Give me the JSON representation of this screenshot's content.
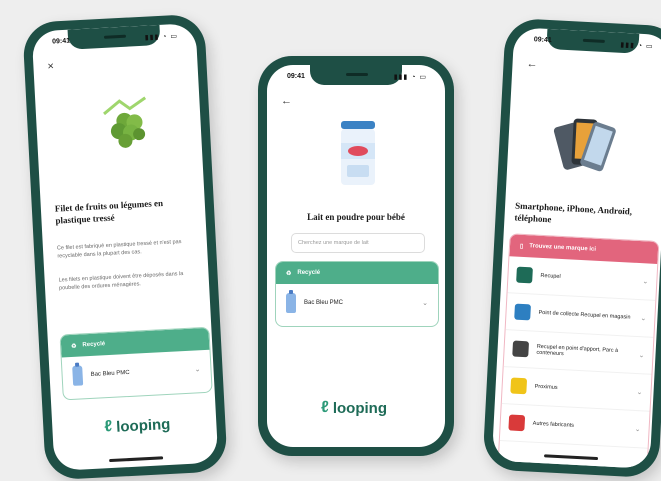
{
  "status": {
    "time": "09:41",
    "icons": "▮▮▮ ◔ ▭"
  },
  "phone1": {
    "close": "×",
    "title": "Filet de fruits ou légumes en plastique tressé",
    "para1": "Ce filet est fabriqué en plastique tressé et n'est pas recyclable dans la plupart des cas.",
    "para2": "Les filets en plastique doivent être déposés dans la poubelle des ordures ménagères.",
    "card_head": "Recyclé",
    "card_item": "Bac Bleu PMC",
    "logo": "looping"
  },
  "phone2": {
    "back": "←",
    "title": "Lait en poudre pour bébé",
    "search_placeholder": "Cherchez une marque de lait",
    "card_head": "Recyclé",
    "card_item": "Bac Bleu PMC",
    "logo": "looping"
  },
  "phone3": {
    "back": "←",
    "title": "Smartphone, iPhone, Android, téléphone",
    "card_head": "Trouvez une marque ici",
    "brands": [
      {
        "label": "Recupel",
        "color": "#1e6b57"
      },
      {
        "label": "Point de collecte Recupel en magasin",
        "color": "#2d7fc1"
      },
      {
        "label": "Recupel en point d'apport, Parc à conteneurs",
        "color": "#444444"
      },
      {
        "label": "Proximus",
        "color": "#f0c419"
      },
      {
        "label": "Autres fabricants",
        "color": "#d93a3a"
      }
    ]
  }
}
